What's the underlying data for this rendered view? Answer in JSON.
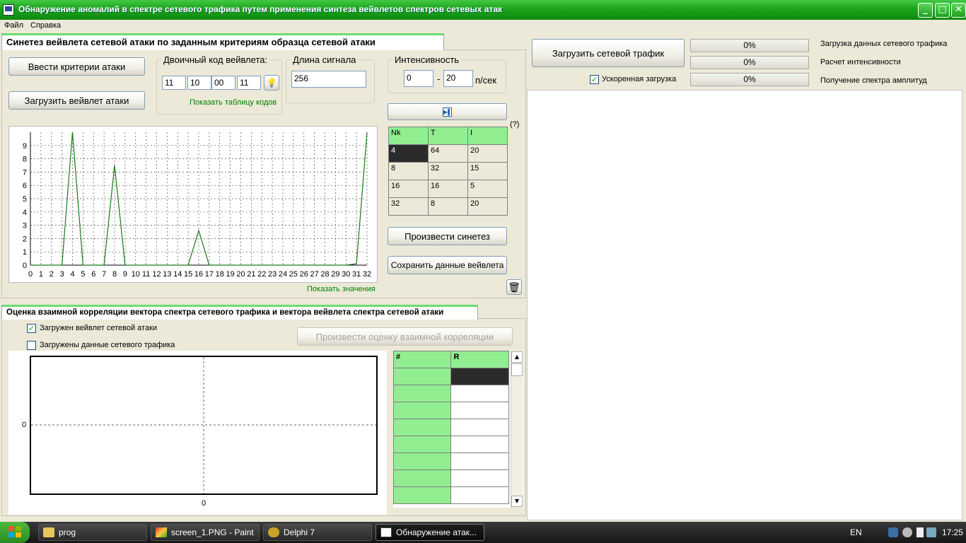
{
  "window": {
    "title": "Обнаружение аномалий в спектре сетевого трафика путем применения синтеза вейвлетов спектров сетевых атак",
    "min": "_",
    "max": "□",
    "close": "✕"
  },
  "menu": {
    "file": "Файл",
    "help": "Справка"
  },
  "synth": {
    "tab": "Синетез вейвлета сетевой атаки по заданным критериям образца сетевой атаки",
    "enter_criteria": "Ввести критерии атаки",
    "load_wavelet": "Загрузить вейвлет атаки",
    "binary_legend": "Двоичный код вейвлета:",
    "codes": [
      "11",
      "10",
      "00",
      "11"
    ],
    "show_codes": "Показать таблицу кодов",
    "length_legend": "Длина сигнала",
    "length_value": "256",
    "intensity_legend": "Интенсивность",
    "int_from": "0",
    "int_dash": "-",
    "int_to": "20",
    "int_unit": "п/сек",
    "help_mark": "(?)",
    "table": {
      "headers": [
        "Nk",
        "T",
        "I"
      ],
      "rows": [
        [
          "4",
          "64",
          "20"
        ],
        [
          "8",
          "32",
          "15"
        ],
        [
          "16",
          "16",
          "5"
        ],
        [
          "32",
          "8",
          "20"
        ]
      ]
    },
    "synth_btn": "Произвести синетез",
    "save_btn": "Сохранить данные вейвлета",
    "show_values": "Показать значения"
  },
  "chart_data": {
    "type": "line",
    "x": [
      0,
      1,
      2,
      3,
      4,
      5,
      6,
      7,
      8,
      9,
      10,
      11,
      12,
      13,
      14,
      15,
      16,
      17,
      18,
      19,
      20,
      21,
      22,
      23,
      24,
      25,
      26,
      27,
      28,
      29,
      30,
      31,
      32
    ],
    "series": [
      {
        "values": [
          0,
          0,
          0,
          0,
          10,
          0,
          0,
          0,
          7.5,
          0,
          0,
          0,
          0,
          0,
          0,
          0,
          2.6,
          0,
          0,
          0,
          0,
          0,
          0,
          0,
          0,
          0,
          0,
          0,
          0,
          0,
          0,
          0.1,
          10
        ]
      }
    ],
    "xlim": [
      0,
      32
    ],
    "ylim": [
      0,
      10
    ],
    "yticks": [
      0,
      1,
      2,
      3,
      4,
      5,
      6,
      7,
      8,
      9
    ],
    "grid": true,
    "color": "#1a7a1a"
  },
  "corr": {
    "tab": "Оценка взаимной корреляции вектора спектра сетевого трафика и вектора вейвлета спектра сетевой атаки",
    "cb_wavelet": "Загружен вейвлет сетевой атаки",
    "cb_wavelet_checked": true,
    "cb_traffic": "Загружены данные сетевого трафика",
    "cb_traffic_checked": false,
    "eval_btn": "Произвести оценку взаимной корреляции",
    "chart_y0": "0",
    "chart_x0": "0",
    "table_headers": [
      "#",
      "R"
    ],
    "scroll_up": "▲",
    "scroll_down": "▼"
  },
  "traffic": {
    "load_btn": "Загрузить сетевой трафик",
    "fast_load": "Ускоренная загрузка",
    "fast_load_checked": true,
    "progress": [
      {
        "value": "0%",
        "label": "Загрузка данных сетевого трафика"
      },
      {
        "value": "0%",
        "label": "Расчет интенсивности"
      },
      {
        "value": "0%",
        "label": "Получение спектра амплитуд"
      }
    ]
  },
  "taskbar": {
    "items": [
      "prog",
      "screen_1.PNG - Paint",
      "Delphi 7",
      "Обнаружение атак..."
    ],
    "lang": "EN",
    "time": "17:25"
  }
}
